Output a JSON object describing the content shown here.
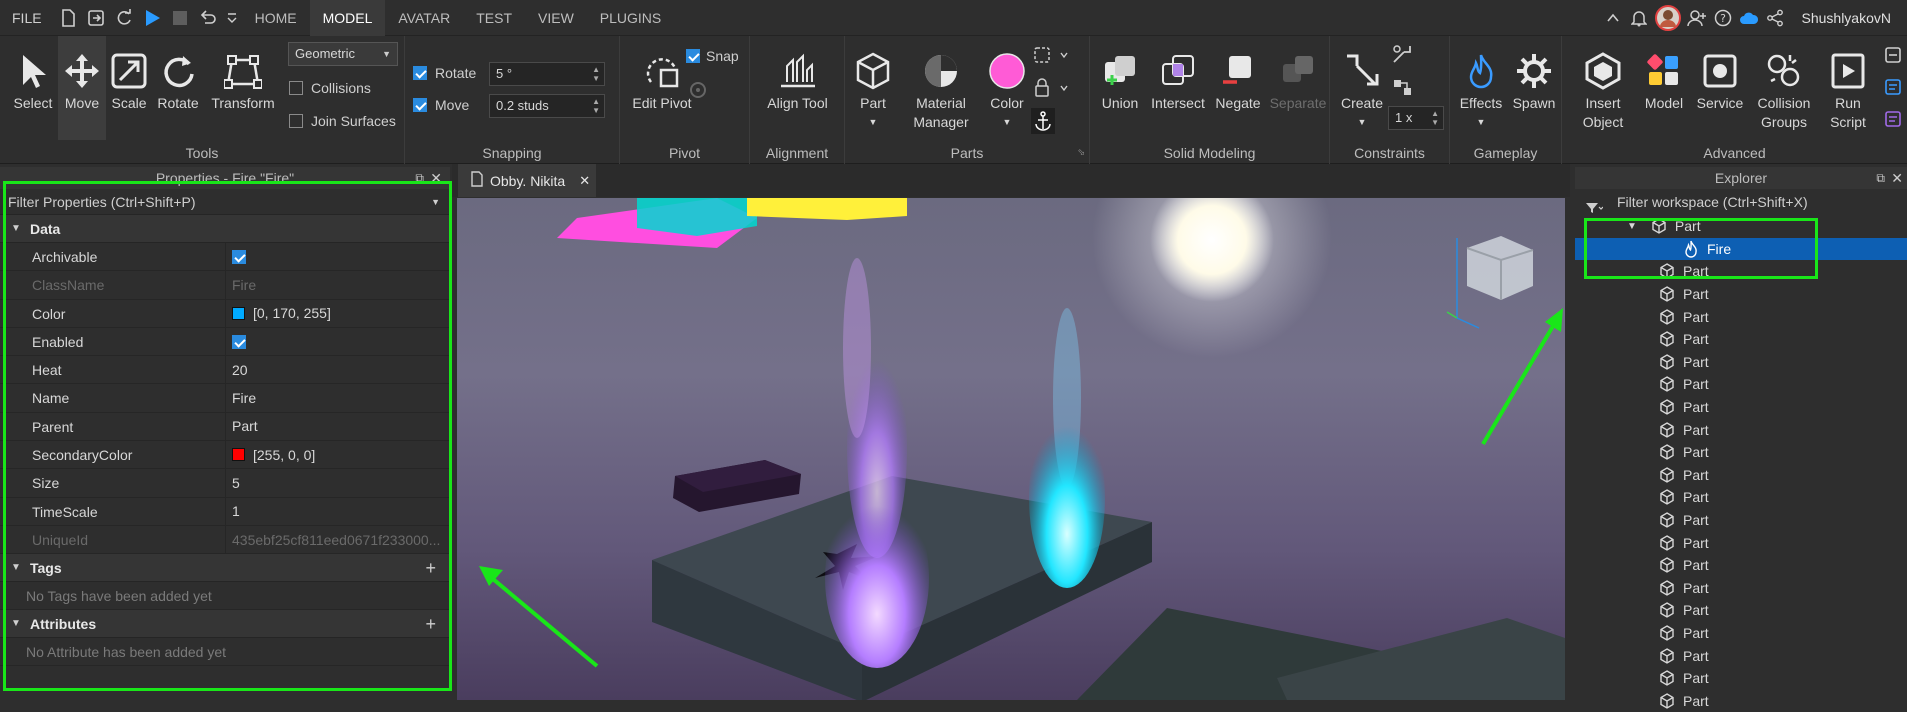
{
  "menubar": {
    "file": "FILE",
    "tabs": [
      "HOME",
      "MODEL",
      "AVATAR",
      "TEST",
      "VIEW",
      "PLUGINS"
    ],
    "active_tab": "MODEL",
    "username": "ShushlyakovN"
  },
  "ribbon": {
    "tools": {
      "caption": "Tools",
      "select": "Select",
      "move": "Move",
      "scale": "Scale",
      "rotate": "Rotate",
      "transform": "Transform",
      "mode": "Geometric",
      "collisions": "Collisions",
      "join_surfaces": "Join Surfaces"
    },
    "snapping": {
      "caption": "Snapping",
      "rotate_label": "Rotate",
      "rotate_value": "5 °",
      "move_label": "Move",
      "move_value": "0.2 studs"
    },
    "pivot": {
      "caption": "Pivot",
      "edit_pivot": "Edit Pivot",
      "snap": "Snap"
    },
    "alignment": {
      "caption": "Alignment",
      "align_tool": "Align Tool"
    },
    "parts": {
      "caption": "Parts",
      "part": "Part",
      "material_manager": "Material Manager",
      "color": "Color"
    },
    "solid_modeling": {
      "caption": "Solid Modeling",
      "union": "Union",
      "intersect": "Intersect",
      "negate": "Negate",
      "separate": "Separate"
    },
    "constraints": {
      "caption": "Constraints",
      "create": "Create",
      "scale_value": "1 x"
    },
    "gameplay": {
      "caption": "Gameplay",
      "effects": "Effects",
      "spawn": "Spawn"
    },
    "advanced": {
      "caption": "Advanced",
      "insert_object": "Insert Object",
      "model": "Model",
      "service": "Service",
      "collision_groups": "Collision Groups",
      "run_script": "Run Script"
    }
  },
  "properties": {
    "title": "Properties - Fire \"Fire\"",
    "filter_placeholder": "Filter Properties (Ctrl+Shift+P)",
    "data_section": "Data",
    "rows": [
      {
        "name": "Archivable",
        "value": "",
        "checkbox": true
      },
      {
        "name": "ClassName",
        "value": "Fire",
        "dim": true
      },
      {
        "name": "Color",
        "value": "[0, 170, 255]",
        "swatch": "#00aaff"
      },
      {
        "name": "Enabled",
        "value": "",
        "checkbox": true
      },
      {
        "name": "Heat",
        "value": "20"
      },
      {
        "name": "Name",
        "value": "Fire"
      },
      {
        "name": "Parent",
        "value": "Part"
      },
      {
        "name": "SecondaryColor",
        "value": "[255, 0, 0]",
        "swatch": "#ff0000"
      },
      {
        "name": "Size",
        "value": "5"
      },
      {
        "name": "TimeScale",
        "value": "1"
      },
      {
        "name": "UniqueId",
        "value": "435ebf25cf811eed0671f233000...",
        "dim": true
      }
    ],
    "tags_section": "Tags",
    "tags_empty": "No Tags have been added yet",
    "attributes_section": "Attributes",
    "attributes_empty": "No Attribute has been added yet"
  },
  "viewport": {
    "tab_label": "Obby. Nikita"
  },
  "explorer": {
    "title": "Explorer",
    "filter_placeholder": "Filter workspace (Ctrl+Shift+X)",
    "parent_item": "Part",
    "selected_item": "Fire",
    "items": [
      "Part",
      "Part",
      "Part",
      "Part",
      "Part",
      "Part",
      "Part",
      "Part",
      "Part",
      "Part",
      "Part",
      "Part",
      "Part",
      "Part",
      "Part",
      "Part",
      "Part",
      "Part",
      "Part",
      "Part"
    ]
  },
  "colors": {
    "highlight": "#19e619",
    "selection": "#0d5fb3",
    "accent": "#2a8bdf"
  }
}
